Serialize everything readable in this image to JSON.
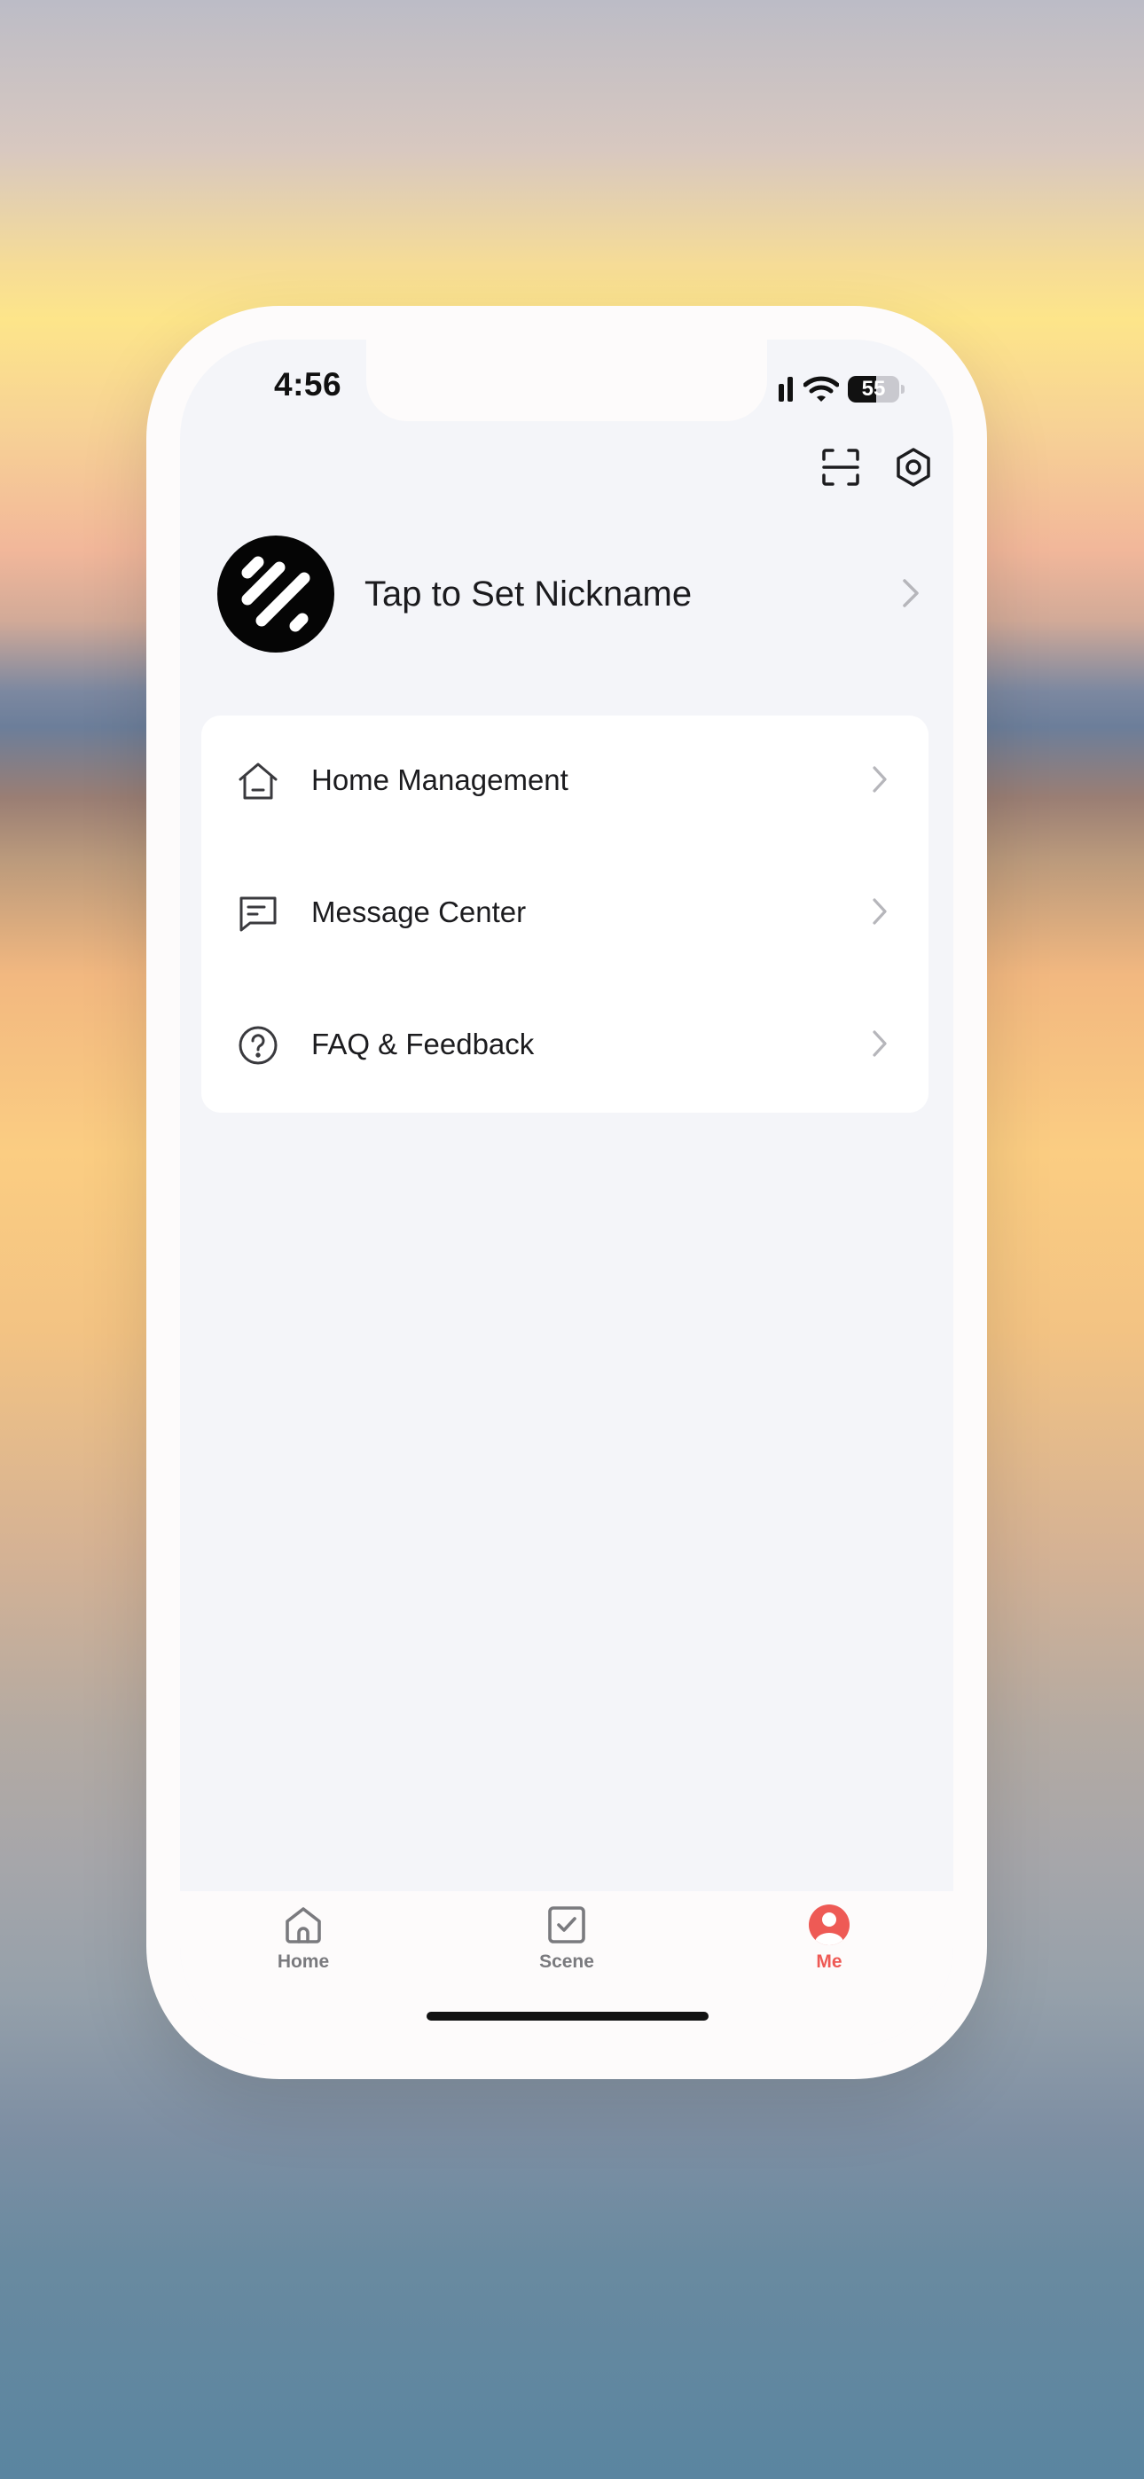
{
  "status_bar": {
    "time": "4:56",
    "battery": "55",
    "battery_level": 0.55
  },
  "toolbar": {
    "scan_icon": "scan-icon",
    "settings_icon": "settings-icon"
  },
  "profile": {
    "nickname_prompt": "Tap to Set Nickname"
  },
  "menu": {
    "items": [
      {
        "label": "Home Management",
        "icon": "house-icon"
      },
      {
        "label": "Message Center",
        "icon": "message-icon"
      },
      {
        "label": "FAQ & Feedback",
        "icon": "question-icon"
      }
    ]
  },
  "tabs": [
    {
      "label": "Home",
      "icon": "home-icon",
      "active": false
    },
    {
      "label": "Scene",
      "icon": "checkbox-icon",
      "active": false
    },
    {
      "label": "Me",
      "icon": "person-icon",
      "active": true
    }
  ],
  "colors": {
    "accent": "#ee5a55",
    "inactive_tab": "#7a7a7e",
    "page_background": "#f4f5f9",
    "card_background": "#ffffff"
  }
}
